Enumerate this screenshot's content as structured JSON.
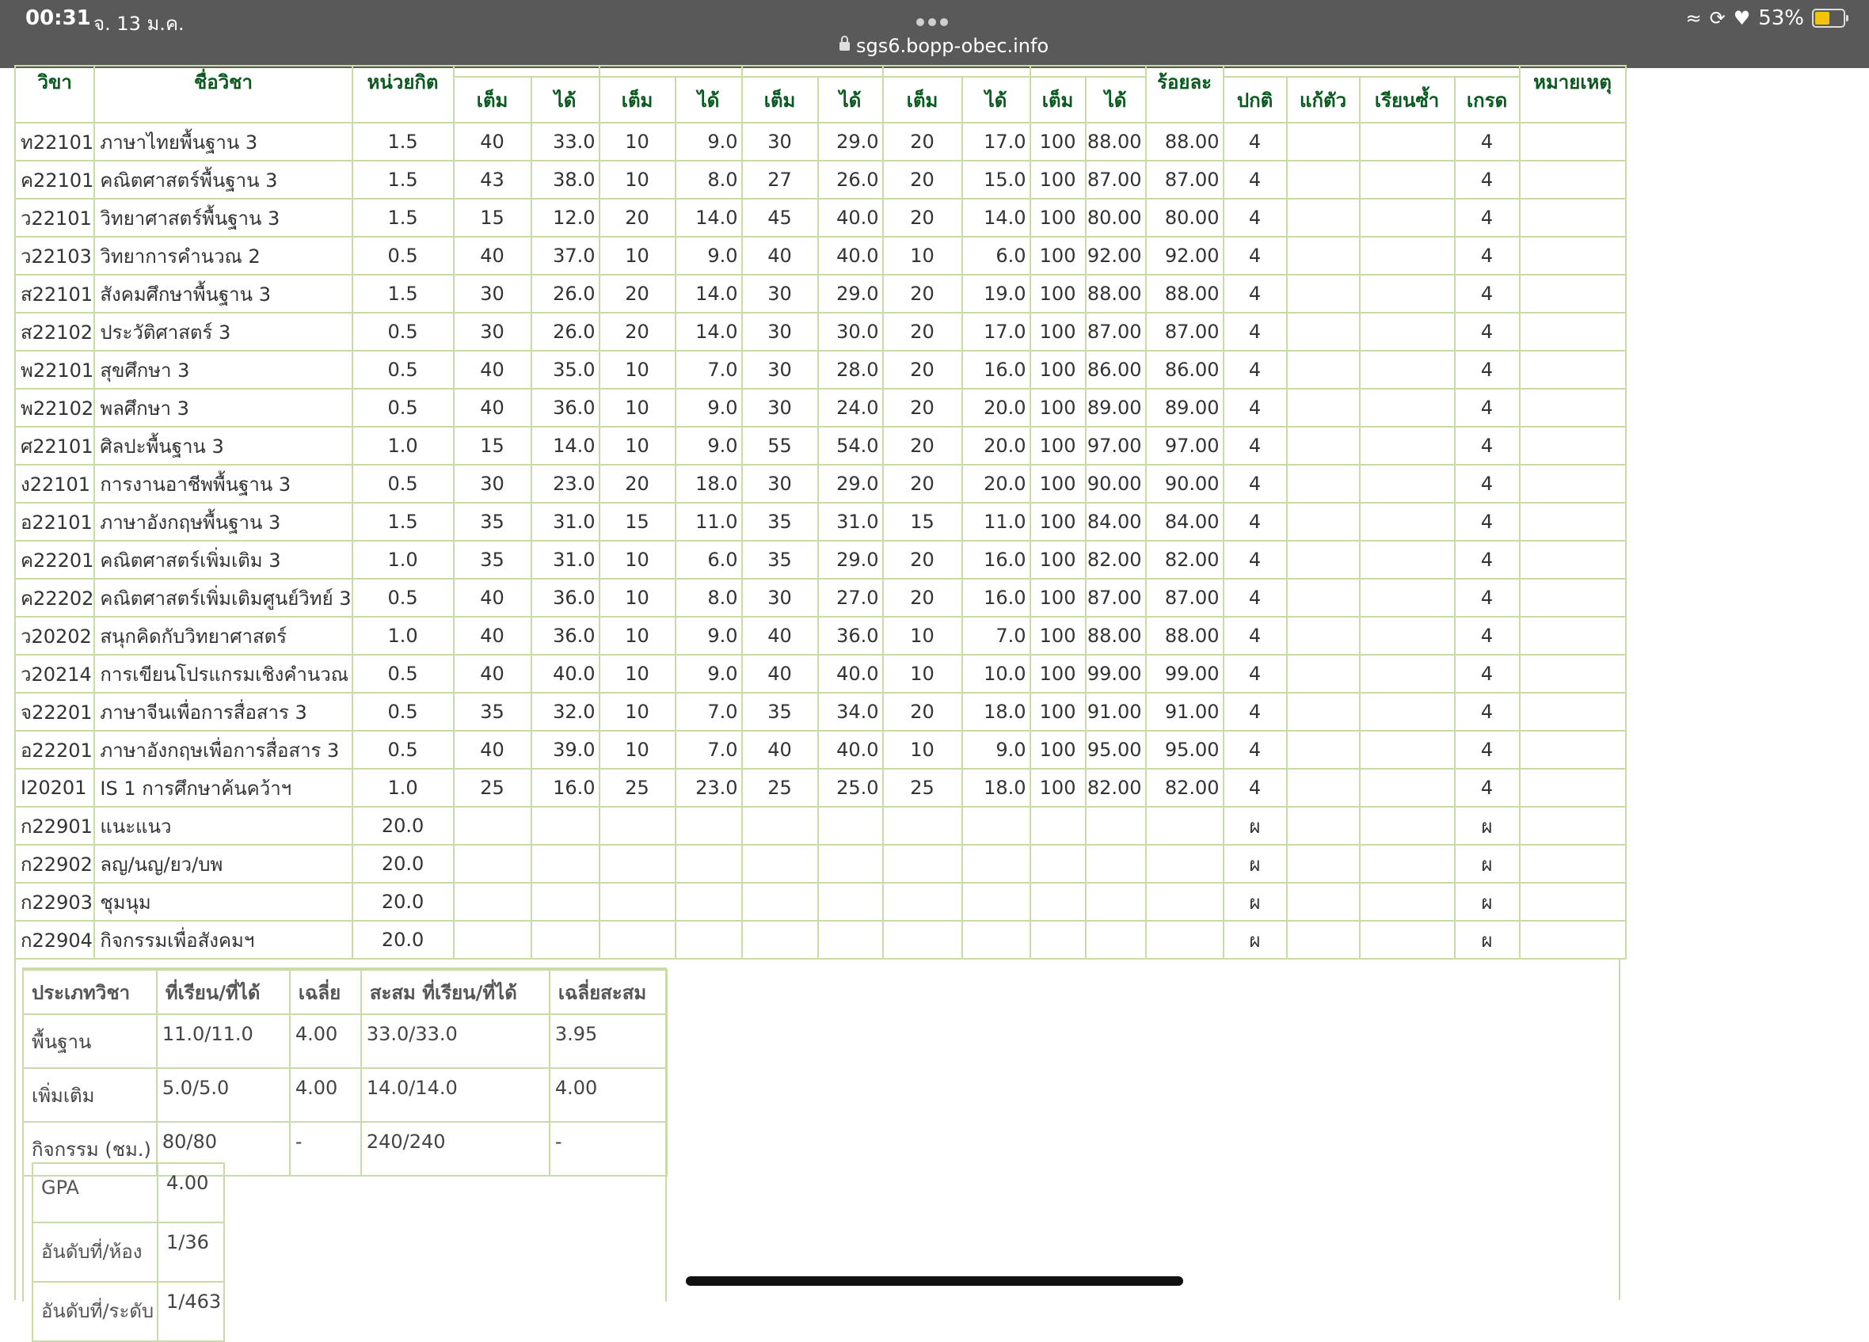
{
  "status_bar": {
    "time": "00:31",
    "date": "จ. 13 ม.ค.",
    "url": "sgs6.bopp-obec.info",
    "battery": "53%"
  },
  "grades_header": {
    "code": "วิขา",
    "name": "ชื่อวิชา",
    "credit": "หน่วยกิต",
    "full": "เต็ม",
    "got": "ได้",
    "percent": "ร้อยละ",
    "normal": "ปกติ",
    "fix": "แก้ตัว",
    "repeat": "เรียนซ้ำ",
    "grade": "เกรด",
    "remark": "หมายเหตุ"
  },
  "grades_rows": [
    {
      "code": "ท22101",
      "name": "ภาษาไทยพื้นฐาน 3",
      "credit": "1.5",
      "s": [
        "40",
        "33.0",
        "10",
        "9.0",
        "30",
        "29.0",
        "20",
        "17.0",
        "100",
        "88.00"
      ],
      "pct": "88.00",
      "normal": "4",
      "fix": "",
      "repeat": "",
      "grade": "4"
    },
    {
      "code": "ค22101",
      "name": "คณิตศาสตร์พื้นฐาน 3",
      "credit": "1.5",
      "s": [
        "43",
        "38.0",
        "10",
        "8.0",
        "27",
        "26.0",
        "20",
        "15.0",
        "100",
        "87.00"
      ],
      "pct": "87.00",
      "normal": "4",
      "fix": "",
      "repeat": "",
      "grade": "4"
    },
    {
      "code": "ว22101",
      "name": "วิทยาศาสตร์พื้นฐาน 3",
      "credit": "1.5",
      "s": [
        "15",
        "12.0",
        "20",
        "14.0",
        "45",
        "40.0",
        "20",
        "14.0",
        "100",
        "80.00"
      ],
      "pct": "80.00",
      "normal": "4",
      "fix": "",
      "repeat": "",
      "grade": "4"
    },
    {
      "code": "ว22103",
      "name": "วิทยาการคำนวณ 2",
      "credit": "0.5",
      "s": [
        "40",
        "37.0",
        "10",
        "9.0",
        "40",
        "40.0",
        "10",
        "6.0",
        "100",
        "92.00"
      ],
      "pct": "92.00",
      "normal": "4",
      "fix": "",
      "repeat": "",
      "grade": "4"
    },
    {
      "code": "ส22101",
      "name": "สังคมศึกษาพื้นฐาน 3",
      "credit": "1.5",
      "s": [
        "30",
        "26.0",
        "20",
        "14.0",
        "30",
        "29.0",
        "20",
        "19.0",
        "100",
        "88.00"
      ],
      "pct": "88.00",
      "normal": "4",
      "fix": "",
      "repeat": "",
      "grade": "4"
    },
    {
      "code": "ส22102",
      "name": "ประวัติศาสตร์ 3",
      "credit": "0.5",
      "s": [
        "30",
        "26.0",
        "20",
        "14.0",
        "30",
        "30.0",
        "20",
        "17.0",
        "100",
        "87.00"
      ],
      "pct": "87.00",
      "normal": "4",
      "fix": "",
      "repeat": "",
      "grade": "4"
    },
    {
      "code": "พ22101",
      "name": "สุขศึกษา 3",
      "credit": "0.5",
      "s": [
        "40",
        "35.0",
        "10",
        "7.0",
        "30",
        "28.0",
        "20",
        "16.0",
        "100",
        "86.00"
      ],
      "pct": "86.00",
      "normal": "4",
      "fix": "",
      "repeat": "",
      "grade": "4"
    },
    {
      "code": "พ22102",
      "name": "พลศึกษา 3",
      "credit": "0.5",
      "s": [
        "40",
        "36.0",
        "10",
        "9.0",
        "30",
        "24.0",
        "20",
        "20.0",
        "100",
        "89.00"
      ],
      "pct": "89.00",
      "normal": "4",
      "fix": "",
      "repeat": "",
      "grade": "4"
    },
    {
      "code": "ศ22101",
      "name": "ศิลปะพื้นฐาน 3",
      "credit": "1.0",
      "s": [
        "15",
        "14.0",
        "10",
        "9.0",
        "55",
        "54.0",
        "20",
        "20.0",
        "100",
        "97.00"
      ],
      "pct": "97.00",
      "normal": "4",
      "fix": "",
      "repeat": "",
      "grade": "4"
    },
    {
      "code": "ง22101",
      "name": "การงานอาชีพพื้นฐาน 3",
      "credit": "0.5",
      "s": [
        "30",
        "23.0",
        "20",
        "18.0",
        "30",
        "29.0",
        "20",
        "20.0",
        "100",
        "90.00"
      ],
      "pct": "90.00",
      "normal": "4",
      "fix": "",
      "repeat": "",
      "grade": "4"
    },
    {
      "code": "อ22101",
      "name": "ภาษาอังกฤษพื้นฐาน 3",
      "credit": "1.5",
      "s": [
        "35",
        "31.0",
        "15",
        "11.0",
        "35",
        "31.0",
        "15",
        "11.0",
        "100",
        "84.00"
      ],
      "pct": "84.00",
      "normal": "4",
      "fix": "",
      "repeat": "",
      "grade": "4"
    },
    {
      "code": "ค22201",
      "name": "คณิตศาสตร์เพิ่มเติม 3",
      "credit": "1.0",
      "s": [
        "35",
        "31.0",
        "10",
        "6.0",
        "35",
        "29.0",
        "20",
        "16.0",
        "100",
        "82.00"
      ],
      "pct": "82.00",
      "normal": "4",
      "fix": "",
      "repeat": "",
      "grade": "4"
    },
    {
      "code": "ค22202",
      "name": "คณิตศาสตร์เพิ่มเติมศูนย์วิทย์ 3",
      "credit": "0.5",
      "s": [
        "40",
        "36.0",
        "10",
        "8.0",
        "30",
        "27.0",
        "20",
        "16.0",
        "100",
        "87.00"
      ],
      "pct": "87.00",
      "normal": "4",
      "fix": "",
      "repeat": "",
      "grade": "4"
    },
    {
      "code": "ว20202",
      "name": "สนุกคิดกับวิทยาศาสตร์",
      "credit": "1.0",
      "s": [
        "40",
        "36.0",
        "10",
        "9.0",
        "40",
        "36.0",
        "10",
        "7.0",
        "100",
        "88.00"
      ],
      "pct": "88.00",
      "normal": "4",
      "fix": "",
      "repeat": "",
      "grade": "4"
    },
    {
      "code": "ว20214",
      "name": "การเขียนโปรแกรมเชิงคำนวณ",
      "credit": "0.5",
      "s": [
        "40",
        "40.0",
        "10",
        "9.0",
        "40",
        "40.0",
        "10",
        "10.0",
        "100",
        "99.00"
      ],
      "pct": "99.00",
      "normal": "4",
      "fix": "",
      "repeat": "",
      "grade": "4"
    },
    {
      "code": "จ22201",
      "name": "ภาษาจีนเพื่อการสื่อสาร 3",
      "credit": "0.5",
      "s": [
        "35",
        "32.0",
        "10",
        "7.0",
        "35",
        "34.0",
        "20",
        "18.0",
        "100",
        "91.00"
      ],
      "pct": "91.00",
      "normal": "4",
      "fix": "",
      "repeat": "",
      "grade": "4"
    },
    {
      "code": "อ22201",
      "name": "ภาษาอังกฤษเพื่อการสื่อสาร 3",
      "credit": "0.5",
      "s": [
        "40",
        "39.0",
        "10",
        "7.0",
        "40",
        "40.0",
        "10",
        "9.0",
        "100",
        "95.00"
      ],
      "pct": "95.00",
      "normal": "4",
      "fix": "",
      "repeat": "",
      "grade": "4"
    },
    {
      "code": "I20201",
      "name": "IS 1 การศึกษาค้นคว้าฯ",
      "credit": "1.0",
      "s": [
        "25",
        "16.0",
        "25",
        "23.0",
        "25",
        "25.0",
        "25",
        "18.0",
        "100",
        "82.00"
      ],
      "pct": "82.00",
      "normal": "4",
      "fix": "",
      "repeat": "",
      "grade": "4"
    },
    {
      "code": "ก22901",
      "name": "แนะแนว",
      "credit": "20.0",
      "s": [
        "",
        "",
        "",
        "",
        "",
        "",
        "",
        "",
        "",
        ""
      ],
      "pct": "",
      "normal": "ผ",
      "fix": "",
      "repeat": "",
      "grade": "ผ"
    },
    {
      "code": "ก22902",
      "name": "ลญ/นญ/ยว/บพ",
      "credit": "20.0",
      "s": [
        "",
        "",
        "",
        "",
        "",
        "",
        "",
        "",
        "",
        ""
      ],
      "pct": "",
      "normal": "ผ",
      "fix": "",
      "repeat": "",
      "grade": "ผ"
    },
    {
      "code": "ก22903",
      "name": "ชุมนุม",
      "credit": "20.0",
      "s": [
        "",
        "",
        "",
        "",
        "",
        "",
        "",
        "",
        "",
        ""
      ],
      "pct": "",
      "normal": "ผ",
      "fix": "",
      "repeat": "",
      "grade": "ผ"
    },
    {
      "code": "ก22904",
      "name": "กิจกรรมเพื่อสังคมฯ",
      "credit": "20.0",
      "s": [
        "",
        "",
        "",
        "",
        "",
        "",
        "",
        "",
        "",
        ""
      ],
      "pct": "",
      "normal": "ผ",
      "fix": "",
      "repeat": "",
      "grade": "ผ"
    }
  ],
  "summary_header": {
    "type": "ประเภทวิชา",
    "studied": "ที่เรียน/ที่ได้",
    "avg": "เฉลี่ย",
    "cum_studied": "สะสม ที่เรียน/ที่ได้",
    "cum_avg": "เฉลี่ยสะสม"
  },
  "summary_rows": [
    {
      "type": "พื้นฐาน",
      "studied": "11.0/11.0",
      "avg": "4.00",
      "cum_studied": "33.0/33.0",
      "cum_avg": "3.95"
    },
    {
      "type": "เพิ่มเติม",
      "studied": "5.0/5.0",
      "avg": "4.00",
      "cum_studied": "14.0/14.0",
      "cum_avg": "4.00"
    },
    {
      "type": "กิจกรรม (ชม.)",
      "studied": "80/80",
      "avg": "-",
      "cum_studied": "240/240",
      "cum_avg": "-"
    }
  ],
  "gpa_rows": [
    {
      "label": "GPA",
      "value": "4.00"
    },
    {
      "label": "อันดับที่/ห้อง",
      "value": "1/36"
    },
    {
      "label": "อันดับที่/ระดับ",
      "value": "1/463"
    }
  ]
}
